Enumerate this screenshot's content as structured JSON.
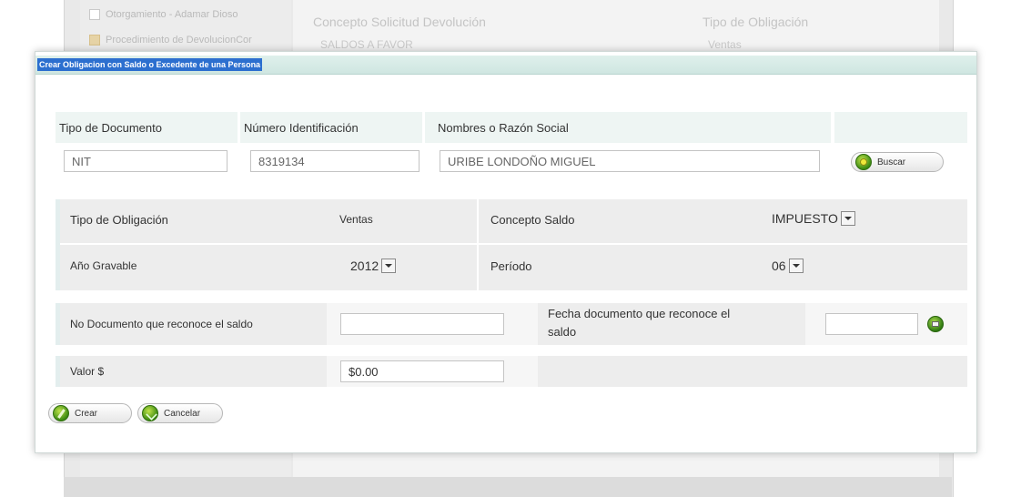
{
  "background": {
    "tree_items": [
      "Otorgamiento - Adamar Dioso",
      "Procedimiento de DevolucionCor"
    ],
    "header_concepto": "Concepto Solicitud Devolución",
    "header_tipo": "Tipo de Obligación",
    "row_concepto": "SALDOS A FAVOR",
    "row_tipo": "Ventas"
  },
  "dialog": {
    "title": "Crear Obligacion con Saldo o Excedente de una Persona"
  },
  "search": {
    "tipo_documento_label": "Tipo de Documento",
    "numero_identificacion_label": "Número Identificación",
    "nombres_label": "Nombres o Razón Social",
    "tipo_documento_value": "NIT",
    "numero_identificacion_value": "8319134",
    "nombres_value": "URIBE LONDOÑO MIGUEL",
    "buscar_label": "Buscar"
  },
  "obligation": {
    "tipo_obligacion_label": "Tipo de Obligación",
    "tipo_obligacion_value": "Ventas",
    "concepto_saldo_label": "Concepto Saldo",
    "concepto_saldo_value": "IMPUESTO",
    "anio_gravable_label": "Año Gravable",
    "anio_gravable_value": "2012",
    "periodo_label": "Período",
    "periodo_value": "06"
  },
  "document": {
    "no_documento_label": "No Documento que reconoce el saldo",
    "no_documento_value": "",
    "fecha_label_line1": "Fecha documento que reconoce el",
    "fecha_label_line2": "saldo",
    "fecha_value": "",
    "valor_label": "Valor $",
    "valor_value": "$0.00"
  },
  "actions": {
    "crear_label": "Crear",
    "cancelar_label": "Cancelar"
  }
}
